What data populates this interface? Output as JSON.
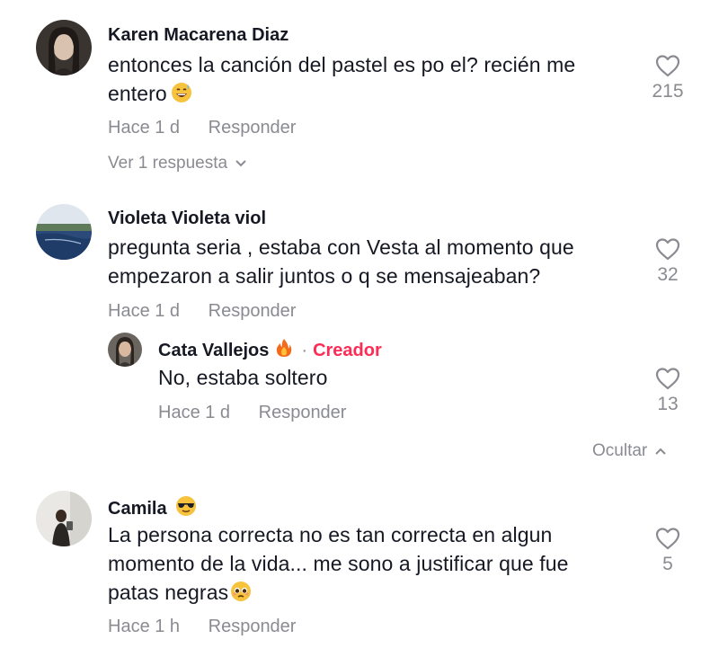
{
  "comments": [
    {
      "username": "Karen Macarena Diaz",
      "text_line1": "entonces la canción del pastel es po el? recién me",
      "text_line2": "entero",
      "emoji": "grinning-sweat-emoji",
      "likes": "215",
      "time": "Hace 1 d",
      "reply_label": "Responder",
      "view_replies": "Ver 1 respuesta"
    },
    {
      "username": "Violeta Violeta viol",
      "text_line1": "pregunta seria , estaba con Vesta al momento que",
      "text_line2": "empezaron a salir juntos o q se mensajeaban?",
      "likes": "32",
      "time": "Hace 1 d",
      "reply_label": "Responder",
      "reply": {
        "username": "Cata Vallejos",
        "badge_emoji": "fire-emoji",
        "separator": "·",
        "creator_label": "Creador",
        "text": "No, estaba soltero",
        "likes": "13",
        "time": "Hace 1 d",
        "reply_label": "Responder"
      },
      "hide_label": "Ocultar"
    },
    {
      "username": "Camila",
      "badge_emoji": "sunglasses-emoji",
      "text_line1": "La persona correcta no es tan correcta en algun",
      "text_line2": "momento de la vida... me sono a justificar que fue",
      "text_line3": "patas negras",
      "emoji": "pleading-face-emoji",
      "likes": "5",
      "time": "Hace 1 h",
      "reply_label": "Responder"
    }
  ],
  "colors": {
    "text": "#161823",
    "secondary": "#8a8b91",
    "creator": "#fe2c55"
  }
}
